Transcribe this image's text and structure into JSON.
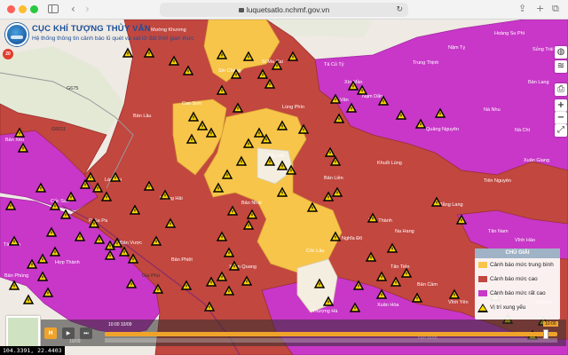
{
  "browser": {
    "url": "luquetsatlo.nchmf.gov.vn"
  },
  "header": {
    "title": "CỤC KHÍ TƯỢNG THỦY VĂN",
    "subtitle": "Hệ thống thông tin cảnh báo lũ quét và sạt lở đất thời gian thực"
  },
  "warning_badge": "20",
  "map": {
    "colors": {
      "high": "#c2473f",
      "medium": "#f7c54a",
      "very_high": "#c837c8",
      "low": "#f2ead8",
      "terrain": "#efeae3",
      "warning_fill": "#ffd900",
      "warning_outline": "#000000"
    },
    "labels": [
      {
        "id": "lbl-muong-khuong",
        "text": "Mường Khương"
      },
      {
        "id": "lbl-si-ma-cai",
        "text": "Si Ma Cai"
      },
      {
        "id": "lbl-sin-cheng",
        "text": "Sin Chéng"
      },
      {
        "id": "lbl-ban-lau",
        "text": "Bản Lầu"
      },
      {
        "id": "lbl-cao-son",
        "text": "Cao Sơn"
      },
      {
        "id": "lbl-lung-phin",
        "text": "Lùng Phìn"
      },
      {
        "id": "lbl-ta-van",
        "text": "Tả Văn"
      },
      {
        "id": "lbl-bac-ha",
        "text": "Bắc Hà"
      },
      {
        "id": "lbl-lao-cai",
        "text": "Lào Cai"
      },
      {
        "id": "lbl-ban-xeo",
        "text": "Bản Xèo"
      },
      {
        "id": "lbl-coc-san",
        "text": "Cốc San"
      },
      {
        "id": "lbl-phong-hai",
        "text": "Phong Hải"
      },
      {
        "id": "lbl-bao-nhai",
        "text": "Bảo Nhai"
      },
      {
        "id": "lbl-ban-lien",
        "text": "Bản Liền"
      },
      {
        "id": "lbl-sa-pa",
        "text": "P. Sa Pa"
      },
      {
        "id": "lbl-ta-phin",
        "text": "Tả Phìn"
      },
      {
        "id": "lbl-hop-thanh",
        "text": "Hợp Thành"
      },
      {
        "id": "lbl-ban-vuoc",
        "text": "Bản Vược"
      },
      {
        "id": "lbl-ban-phiet",
        "text": "Bản Phiệt"
      },
      {
        "id": "lbl-coc-lau",
        "text": "Cốc Lầu"
      },
      {
        "id": "lbl-xuan-quang",
        "text": "Xuân Quang"
      },
      {
        "id": "lbl-ban-phung",
        "text": "Bản Phùng"
      },
      {
        "id": "lbl-gia-phu",
        "text": "Gia Phú"
      },
      {
        "id": "lbl-thuong-ha",
        "text": "Thượng Hà"
      },
      {
        "id": "lbl-nghia-do",
        "text": "Nghĩa Đô"
      },
      {
        "id": "lbl-tan-tien",
        "text": "Tân Tiến"
      },
      {
        "id": "lbl-yen-thanh",
        "text": "Yên Thành"
      },
      {
        "id": "lbl-xuan-hoa",
        "text": "Xuân Hòa"
      },
      {
        "id": "lbl-vinh-yen",
        "text": "Vĩnh Yên"
      },
      {
        "id": "lbl-khuoi-luong",
        "text": "Khuổi Lùng"
      },
      {
        "id": "lbl-trung-thinh",
        "text": "Trung Thịnh"
      },
      {
        "id": "lbl-nam-dan",
        "text": "Nậm Dẩn"
      },
      {
        "id": "lbl-quang-nguyen",
        "text": "Quảng Nguyên"
      },
      {
        "id": "lbl-nai-nhu",
        "text": "Nà Nhu"
      },
      {
        "id": "lbl-na-chi",
        "text": "Nà Chì"
      },
      {
        "id": "lbl-tien-nguyen",
        "text": "Tiên Nguyên"
      },
      {
        "id": "lbl-bang-lang",
        "text": "Bằng Lang"
      },
      {
        "id": "lbl-xuan-giang",
        "text": "Xuân Giang"
      },
      {
        "id": "lbl-tan-nam",
        "text": "Tân Nam"
      },
      {
        "id": "lbl-hoang-su-phi",
        "text": "Hoàng Su Phì"
      },
      {
        "id": "lbl-sin-man",
        "text": "Xín Mần"
      },
      {
        "id": "lbl-nam-ty",
        "text": "Nậm Tỵ"
      },
      {
        "id": "lbl-ta-cu-ty",
        "text": "Tả Củ Tỷ"
      },
      {
        "id": "lbl-ban-lang",
        "text": "Bản Lang"
      },
      {
        "id": "lbl-bac-ngam",
        "text": "Bắc Ngầm"
      },
      {
        "id": "lbl-ban-cam",
        "text": "Bản Cầm"
      },
      {
        "id": "lbl-vu-linh",
        "text": "Vũ Linh"
      },
      {
        "id": "lbl-vinh-hao",
        "text": "Vĩnh Hảo"
      },
      {
        "id": "lbl-na-hang",
        "text": "Na Hang"
      },
      {
        "id": "lbl-sung-trai",
        "text": "Sủng Trái"
      },
      {
        "id": "lbl-yen-binh",
        "text": "Yên Bình"
      },
      {
        "id": "lbl-g675",
        "text": "G675"
      },
      {
        "id": "lbl-g6011",
        "text": "G6011"
      }
    ],
    "marker_icon": "warning-triangle-icon"
  },
  "controls": {
    "globe": "globe-icon",
    "layers": "layers-icon",
    "print": "print-icon",
    "zoom_in": "+",
    "zoom_out": "−",
    "fullscreen": "fullscreen-icon"
  },
  "legend": {
    "title": "CHÚ GIẢI",
    "items": [
      {
        "label": "Cảnh báo mức trung bình",
        "color": "#f7c54a"
      },
      {
        "label": "Cảnh báo mức cao",
        "color": "#c2473f"
      },
      {
        "label": "Cảnh báo mức rất cao",
        "color": "#c837c8"
      },
      {
        "label": "Vị trí xung yếu",
        "icon": "warning-triangle-icon"
      }
    ]
  },
  "timeline": {
    "history_label": "H",
    "start_label": "10:00 10/09",
    "end_label": "10:00",
    "sub_label": "10/09",
    "progress": 0.98
  },
  "coordinates": "104.3391, 22.4403"
}
